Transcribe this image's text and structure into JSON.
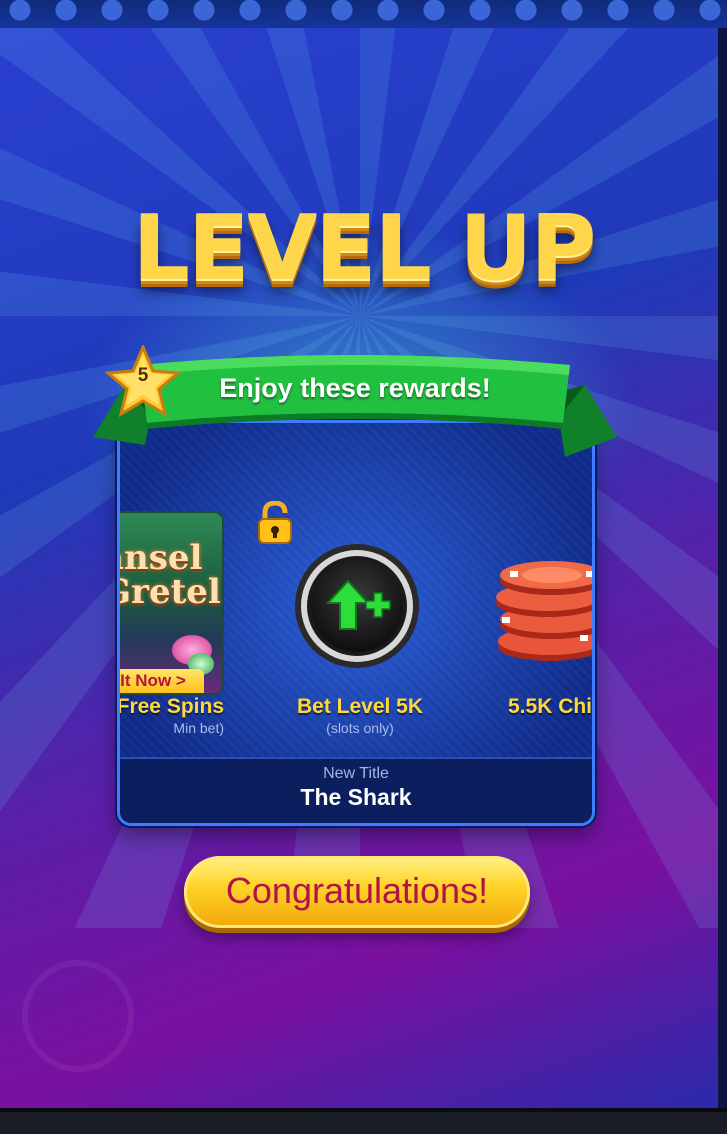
{
  "header": {
    "title": "LEVEL UP"
  },
  "banner": {
    "text": "Enjoy these rewards!",
    "level": "5"
  },
  "rewards": [
    {
      "game_card_text": "ansel\nGretel",
      "game_card_button": "y It Now >",
      "label": "Free Spins",
      "sub": "Min bet)",
      "icon": "slot-game-card-icon"
    },
    {
      "label": "Bet Level 5K",
      "sub": "(slots only)",
      "icon": "bet-level-up-icon",
      "badge_icon": "unlocked-padlock-icon"
    },
    {
      "label": "5.5K Chi",
      "icon": "casino-chips-stack-icon"
    }
  ],
  "new_title": {
    "label": "New Title",
    "value": "The Shark"
  },
  "congrats_button": {
    "label": "Congratulations!"
  },
  "colors": {
    "gold": "#ffd54a",
    "ribbon_green": "#22c040",
    "button_text": "#b0124a",
    "panel_blue": "#143aa8"
  }
}
